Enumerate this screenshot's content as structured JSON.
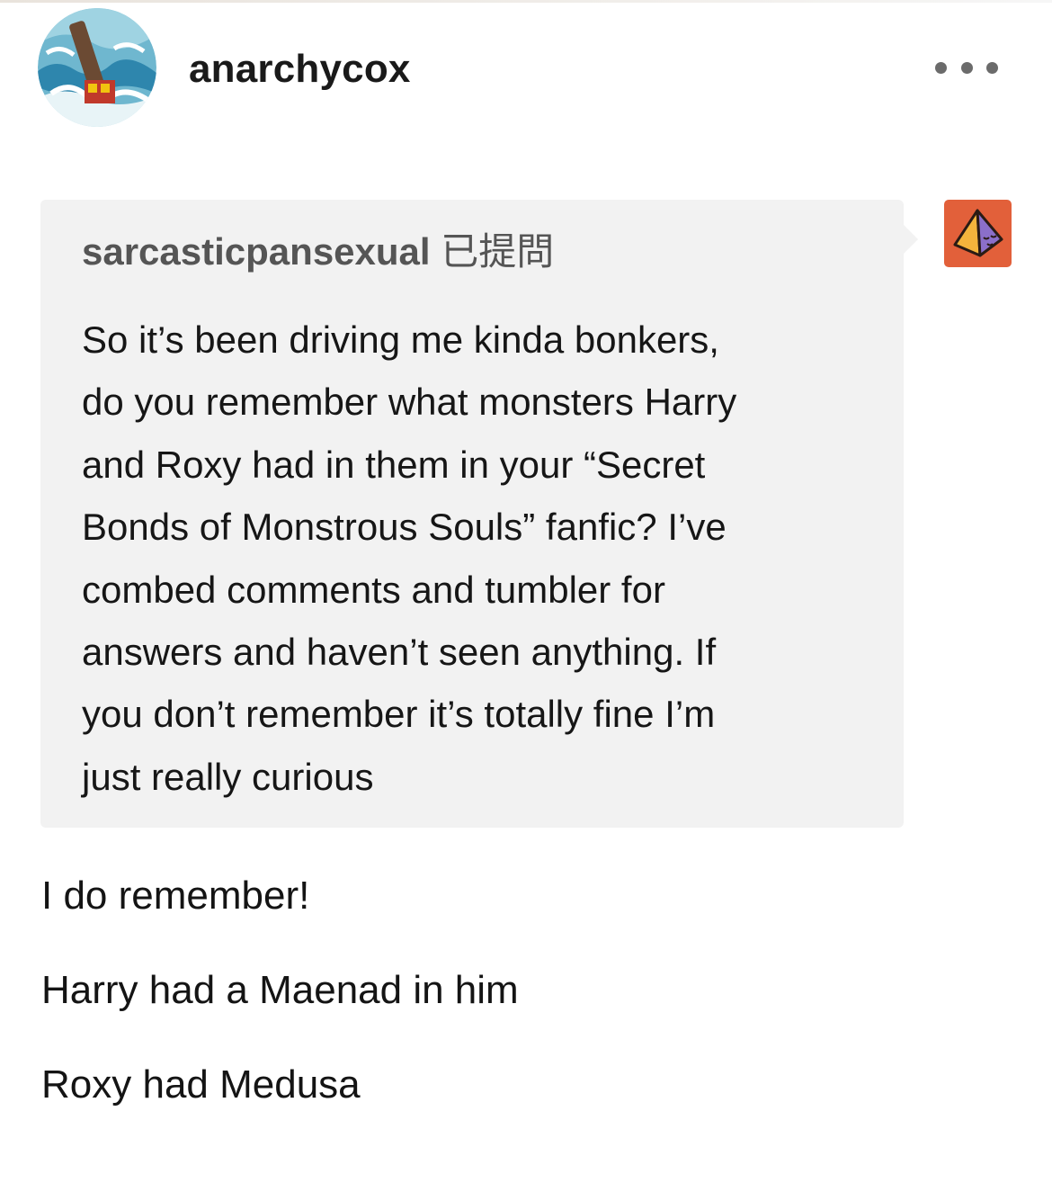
{
  "post": {
    "author": "anarchycox",
    "avatar_icon": "avatar-anarchycox",
    "more_icon": "ellipsis-icon"
  },
  "ask": {
    "asker": "sarcasticpansexual",
    "asked_label": "已提問",
    "asker_avatar_icon": "pyramid-avatar-icon",
    "question_lines": [
      "So it’s been driving me kinda bonkers,",
      "do you remember what monsters Harry",
      "and Roxy had in them in your “Secret",
      "Bonds of Monstrous Souls” fanfic? I’ve",
      "combed comments and tumbler for",
      "answers and haven’t seen anything. If",
      "you don’t remember it’s totally fine I’m",
      "just really curious"
    ]
  },
  "answer": {
    "paragraphs": [
      "I do remember!",
      "Harry had a Maenad in him",
      "Roxy had Medusa"
    ]
  },
  "colors": {
    "ask_background": "#f2f2f2",
    "asker_avatar_bg": "#e2603a"
  }
}
